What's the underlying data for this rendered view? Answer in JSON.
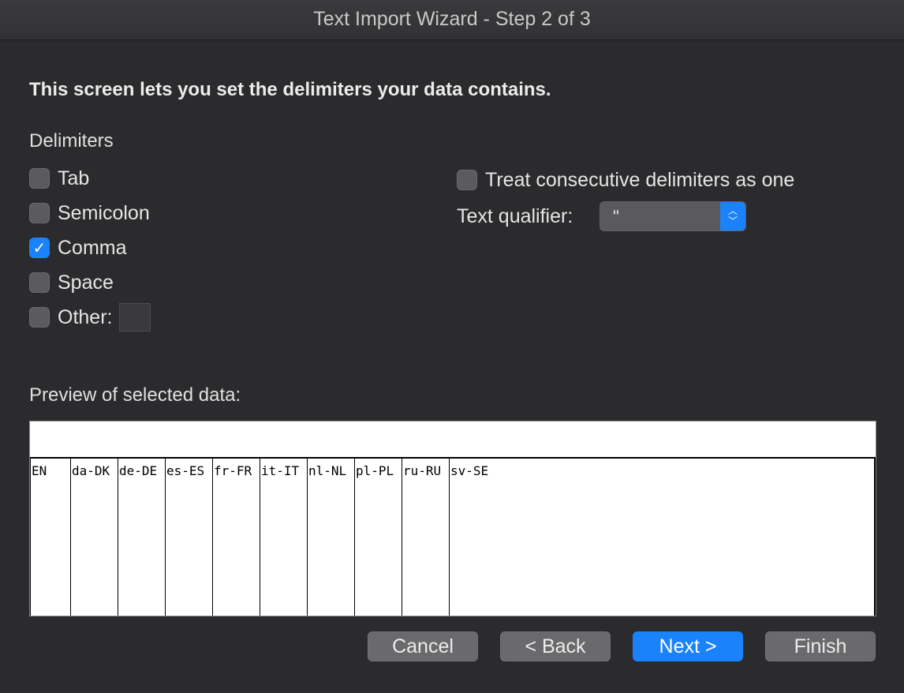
{
  "window": {
    "title": "Text Import Wizard - Step 2 of 3"
  },
  "heading": "This screen lets you set the delimiters your data contains.",
  "delimiters": {
    "label": "Delimiters",
    "tab": "Tab",
    "semicolon": "Semicolon",
    "comma": "Comma",
    "space": "Space",
    "other": "Other:",
    "other_value": ""
  },
  "options": {
    "treat_consecutive": "Treat consecutive delimiters as one",
    "qualifier_label": "Text qualifier:",
    "qualifier_value": "\""
  },
  "preview": {
    "label": "Preview of selected data:",
    "columns": [
      "EN",
      "da-DK",
      "de-DE",
      "es-ES",
      "fr-FR",
      "it-IT",
      "nl-NL",
      "pl-PL",
      "ru-RU",
      "sv-SE"
    ]
  },
  "buttons": {
    "cancel": "Cancel",
    "back": "< Back",
    "next": "Next >",
    "finish": "Finish"
  },
  "colors": {
    "accent": "#1a82fb",
    "background": "#2b2b2d"
  }
}
